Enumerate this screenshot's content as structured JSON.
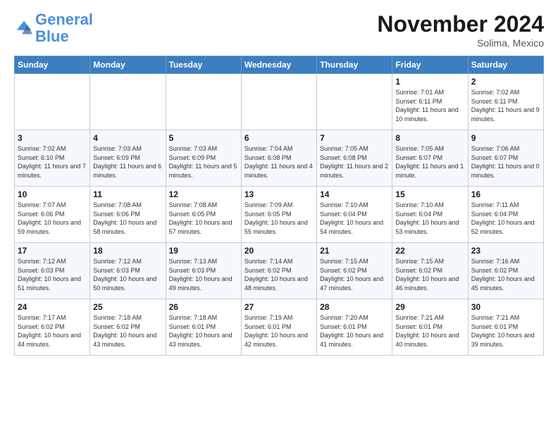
{
  "header": {
    "logo_line1": "General",
    "logo_line2": "Blue",
    "month": "November 2024",
    "location": "Solima, Mexico"
  },
  "days_of_week": [
    "Sunday",
    "Monday",
    "Tuesday",
    "Wednesday",
    "Thursday",
    "Friday",
    "Saturday"
  ],
  "weeks": [
    [
      {
        "day": "",
        "info": ""
      },
      {
        "day": "",
        "info": ""
      },
      {
        "day": "",
        "info": ""
      },
      {
        "day": "",
        "info": ""
      },
      {
        "day": "",
        "info": ""
      },
      {
        "day": "1",
        "info": "Sunrise: 7:01 AM\nSunset: 6:11 PM\nDaylight: 11 hours and 10 minutes."
      },
      {
        "day": "2",
        "info": "Sunrise: 7:02 AM\nSunset: 6:11 PM\nDaylight: 11 hours and 9 minutes."
      }
    ],
    [
      {
        "day": "3",
        "info": "Sunrise: 7:02 AM\nSunset: 6:10 PM\nDaylight: 11 hours and 7 minutes."
      },
      {
        "day": "4",
        "info": "Sunrise: 7:03 AM\nSunset: 6:09 PM\nDaylight: 11 hours and 6 minutes."
      },
      {
        "day": "5",
        "info": "Sunrise: 7:03 AM\nSunset: 6:09 PM\nDaylight: 11 hours and 5 minutes."
      },
      {
        "day": "6",
        "info": "Sunrise: 7:04 AM\nSunset: 6:08 PM\nDaylight: 11 hours and 4 minutes."
      },
      {
        "day": "7",
        "info": "Sunrise: 7:05 AM\nSunset: 6:08 PM\nDaylight: 11 hours and 2 minutes."
      },
      {
        "day": "8",
        "info": "Sunrise: 7:05 AM\nSunset: 6:07 PM\nDaylight: 11 hours and 1 minute."
      },
      {
        "day": "9",
        "info": "Sunrise: 7:06 AM\nSunset: 6:07 PM\nDaylight: 11 hours and 0 minutes."
      }
    ],
    [
      {
        "day": "10",
        "info": "Sunrise: 7:07 AM\nSunset: 6:06 PM\nDaylight: 10 hours and 59 minutes."
      },
      {
        "day": "11",
        "info": "Sunrise: 7:08 AM\nSunset: 6:06 PM\nDaylight: 10 hours and 58 minutes."
      },
      {
        "day": "12",
        "info": "Sunrise: 7:08 AM\nSunset: 6:05 PM\nDaylight: 10 hours and 57 minutes."
      },
      {
        "day": "13",
        "info": "Sunrise: 7:09 AM\nSunset: 6:05 PM\nDaylight: 10 hours and 55 minutes."
      },
      {
        "day": "14",
        "info": "Sunrise: 7:10 AM\nSunset: 6:04 PM\nDaylight: 10 hours and 54 minutes."
      },
      {
        "day": "15",
        "info": "Sunrise: 7:10 AM\nSunset: 6:04 PM\nDaylight: 10 hours and 53 minutes."
      },
      {
        "day": "16",
        "info": "Sunrise: 7:11 AM\nSunset: 6:04 PM\nDaylight: 10 hours and 52 minutes."
      }
    ],
    [
      {
        "day": "17",
        "info": "Sunrise: 7:12 AM\nSunset: 6:03 PM\nDaylight: 10 hours and 51 minutes."
      },
      {
        "day": "18",
        "info": "Sunrise: 7:12 AM\nSunset: 6:03 PM\nDaylight: 10 hours and 50 minutes."
      },
      {
        "day": "19",
        "info": "Sunrise: 7:13 AM\nSunset: 6:03 PM\nDaylight: 10 hours and 49 minutes."
      },
      {
        "day": "20",
        "info": "Sunrise: 7:14 AM\nSunset: 6:02 PM\nDaylight: 10 hours and 48 minutes."
      },
      {
        "day": "21",
        "info": "Sunrise: 7:15 AM\nSunset: 6:02 PM\nDaylight: 10 hours and 47 minutes."
      },
      {
        "day": "22",
        "info": "Sunrise: 7:15 AM\nSunset: 6:02 PM\nDaylight: 10 hours and 46 minutes."
      },
      {
        "day": "23",
        "info": "Sunrise: 7:16 AM\nSunset: 6:02 PM\nDaylight: 10 hours and 45 minutes."
      }
    ],
    [
      {
        "day": "24",
        "info": "Sunrise: 7:17 AM\nSunset: 6:02 PM\nDaylight: 10 hours and 44 minutes."
      },
      {
        "day": "25",
        "info": "Sunrise: 7:18 AM\nSunset: 6:02 PM\nDaylight: 10 hours and 43 minutes."
      },
      {
        "day": "26",
        "info": "Sunrise: 7:18 AM\nSunset: 6:01 PM\nDaylight: 10 hours and 43 minutes."
      },
      {
        "day": "27",
        "info": "Sunrise: 7:19 AM\nSunset: 6:01 PM\nDaylight: 10 hours and 42 minutes."
      },
      {
        "day": "28",
        "info": "Sunrise: 7:20 AM\nSunset: 6:01 PM\nDaylight: 10 hours and 41 minutes."
      },
      {
        "day": "29",
        "info": "Sunrise: 7:21 AM\nSunset: 6:01 PM\nDaylight: 10 hours and 40 minutes."
      },
      {
        "day": "30",
        "info": "Sunrise: 7:21 AM\nSunset: 6:01 PM\nDaylight: 10 hours and 39 minutes."
      }
    ]
  ]
}
